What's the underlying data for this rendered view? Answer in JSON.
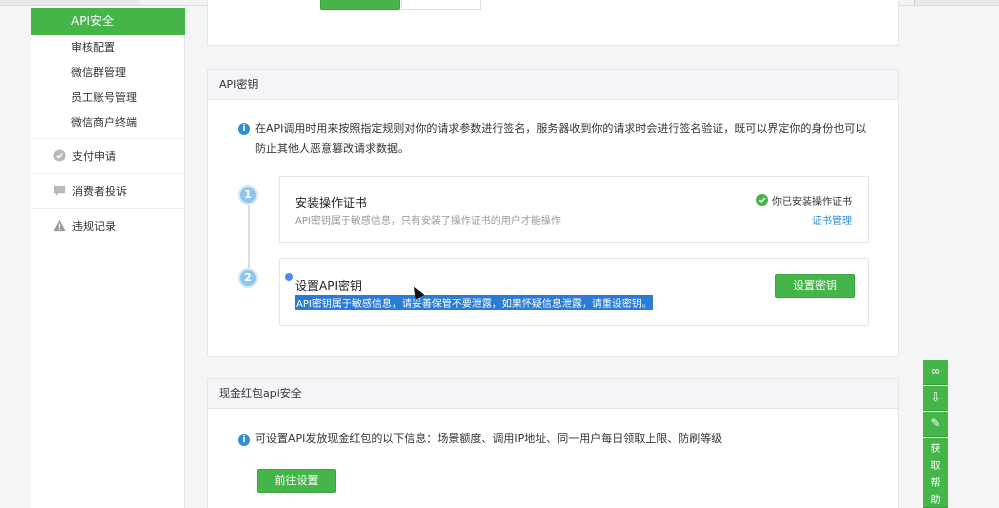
{
  "sidebar": {
    "active_item": "API安全",
    "sub_items": [
      "审核配置",
      "微信群管理",
      "员工账号管理",
      "微信商户终端"
    ],
    "sections": [
      {
        "label": "支付申请",
        "icon": "check-circle-icon"
      },
      {
        "label": "消费者投诉",
        "icon": "chat-bubble-icon"
      },
      {
        "label": "违规记录",
        "icon": "warning-icon"
      }
    ]
  },
  "api_key_card": {
    "title": "API密钥",
    "info": "在API调用时用来按照指定规则对你的请求参数进行签名，服务器收到你的请求时会进行签名验证，既可以界定你的身份也可以防止其他人恶意篡改请求数据。",
    "steps": [
      {
        "number": "1",
        "title": "安装操作证书",
        "desc": "API密钥属于敏感信息，只有安装了操作证书的用户才能操作",
        "status": "你已安装操作证书",
        "link": "证书管理"
      },
      {
        "number": "2",
        "title": "设置API密钥",
        "desc": "API密钥属于敏感信息，请妥善保管不要泄露，如果怀疑信息泄露，请重设密钥。",
        "button": "设置密钥"
      }
    ]
  },
  "red_packet_card": {
    "title": "现金红包api安全",
    "info": "可设置API发放现金红包的以下信息：场景额度、调用IP地址、同一用户每日领取上限、防刷等级",
    "button": "前往设置"
  },
  "right_tools": {
    "help_label": "获取帮助",
    "icons": [
      "link-icon",
      "download-icon",
      "edit-icon"
    ]
  },
  "colors": {
    "accent_green": "#44b549",
    "info_blue": "#2e8fd5",
    "link_blue": "#2e8fd5",
    "selection_blue": "#2a7dd6"
  }
}
